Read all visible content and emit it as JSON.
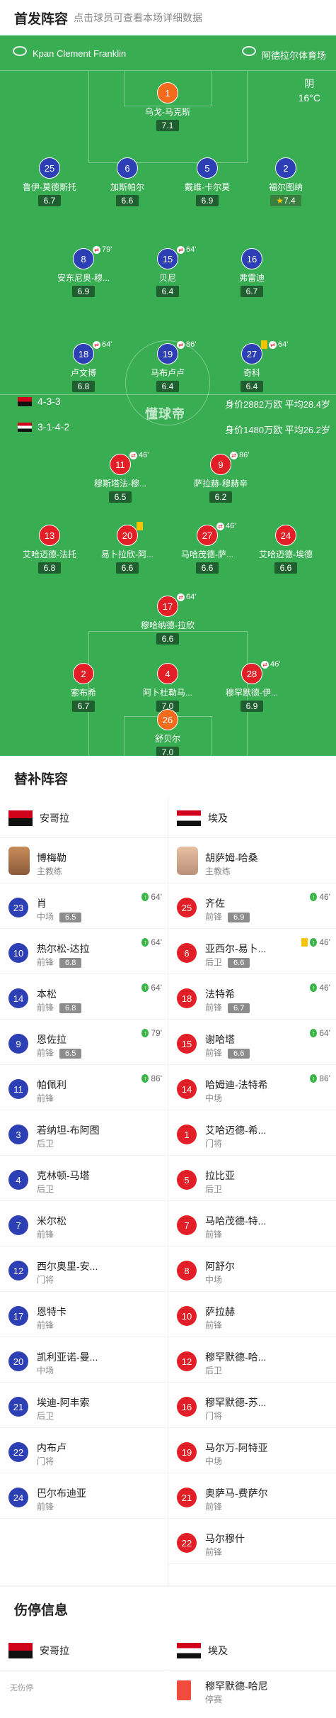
{
  "header": {
    "title": "首发阵容",
    "subtitle": "点击球员可查看本场详细数据"
  },
  "venue": {
    "left": "Kpan Clement Franklin",
    "right": "阿德拉尔体育场"
  },
  "weather": {
    "cond": "阴",
    "temp": "16°C"
  },
  "watermark": "懂球帝",
  "home_info": {
    "formation": "4-3-3",
    "value": "身价2882万欧 平均28.4岁"
  },
  "away_info": {
    "formation": "3-1-4-2",
    "value": "身价1480万欧 平均26.2岁"
  },
  "home_players": [
    {
      "num": "1",
      "name": "乌戈-马克斯",
      "rating": "7.1",
      "color": "o"
    },
    {
      "num": "25",
      "name": "鲁伊-莫德斯托",
      "rating": "6.7",
      "color": "b"
    },
    {
      "num": "6",
      "name": "加斯帕尔",
      "rating": "6.6",
      "color": "b"
    },
    {
      "num": "5",
      "name": "戴维-卡尔莫",
      "rating": "6.9",
      "color": "b"
    },
    {
      "num": "2",
      "name": "福尔图纳",
      "rating": "7.4",
      "color": "b",
      "star": "★"
    },
    {
      "num": "8",
      "name": "安东尼奥-穆...",
      "rating": "6.9",
      "color": "b",
      "sub": "79'"
    },
    {
      "num": "15",
      "name": "贝尼",
      "rating": "6.4",
      "color": "b",
      "sub": "64'"
    },
    {
      "num": "16",
      "name": "弗雷迪",
      "rating": "6.7",
      "color": "b",
      "cap": "C"
    },
    {
      "num": "18",
      "name": "卢文博",
      "rating": "6.8",
      "color": "b",
      "sub": "64'"
    },
    {
      "num": "19",
      "name": "马布卢卢",
      "rating": "6.4",
      "color": "b",
      "sub": "86'"
    },
    {
      "num": "27",
      "name": "奇科",
      "rating": "6.4",
      "color": "b",
      "sub": "64'",
      "yc": true
    }
  ],
  "away_players": [
    {
      "num": "11",
      "name": "穆斯塔法-穆...",
      "rating": "6.5",
      "color": "r",
      "sub": "46'"
    },
    {
      "num": "9",
      "name": "萨拉赫-穆赫辛",
      "rating": "6.2",
      "color": "r",
      "sub": "86'",
      "cap": "C"
    },
    {
      "num": "13",
      "name": "艾哈迈德-法托",
      "rating": "6.8",
      "color": "r"
    },
    {
      "num": "20",
      "name": "易卜拉欣-阿...",
      "rating": "6.6",
      "color": "r",
      "yc": true
    },
    {
      "num": "27",
      "name": "马哈茂德-萨...",
      "rating": "6.6",
      "color": "r",
      "sub": "46'"
    },
    {
      "num": "24",
      "name": "艾哈迈德-埃德",
      "rating": "6.6",
      "color": "r"
    },
    {
      "num": "17",
      "name": "穆哈纳德-拉欣",
      "rating": "6.6",
      "color": "r",
      "sub": "64'"
    },
    {
      "num": "2",
      "name": "索布希",
      "rating": "6.7",
      "color": "r"
    },
    {
      "num": "4",
      "name": "阿卜杜勒马...",
      "rating": "7.0",
      "color": "r"
    },
    {
      "num": "28",
      "name": "穆罕默德-伊...",
      "rating": "6.9",
      "color": "r",
      "sub": "46'"
    },
    {
      "num": "26",
      "name": "舒贝尔",
      "rating": "7.0",
      "color": "o"
    }
  ],
  "subs": {
    "title": "替补阵容",
    "home_team": "安哥拉",
    "away_team": "埃及",
    "home_coach": {
      "name": "博梅勒",
      "role": "主教练"
    },
    "away_coach": {
      "name": "胡萨姆-哈桑",
      "role": "主教练"
    },
    "home": [
      {
        "num": "23",
        "name": "肖",
        "pos": "中场",
        "rating": "6.5",
        "in": "64'"
      },
      {
        "num": "10",
        "name": "热尔松-达拉",
        "pos": "前锋",
        "rating": "6.8",
        "in": "64'"
      },
      {
        "num": "14",
        "name": "本松",
        "pos": "前锋",
        "rating": "6.8",
        "in": "64'"
      },
      {
        "num": "9",
        "name": "恩佐拉",
        "pos": "前锋",
        "rating": "6.5",
        "in": "79'"
      },
      {
        "num": "11",
        "name": "帕佩利",
        "pos": "前锋",
        "in": "86'"
      },
      {
        "num": "3",
        "name": "若纳坦-布阿图",
        "pos": "后卫"
      },
      {
        "num": "4",
        "name": "克林顿-马塔",
        "pos": "后卫"
      },
      {
        "num": "7",
        "name": "米尔松",
        "pos": "前锋"
      },
      {
        "num": "12",
        "name": "西尔奥里-安...",
        "pos": "门将"
      },
      {
        "num": "17",
        "name": "恩特卡",
        "pos": "前锋"
      },
      {
        "num": "20",
        "name": "凯利亚诺-曼...",
        "pos": "中场"
      },
      {
        "num": "21",
        "name": "埃迪-阿丰索",
        "pos": "后卫"
      },
      {
        "num": "22",
        "name": "内布卢",
        "pos": "门将"
      },
      {
        "num": "24",
        "name": "巴尔布迪亚",
        "pos": "前锋"
      }
    ],
    "away": [
      {
        "num": "25",
        "name": "齐佐",
        "pos": "前锋",
        "rating": "6.9",
        "in": "46'"
      },
      {
        "num": "6",
        "name": "亚西尔-易卜...",
        "pos": "后卫",
        "rating": "6.6",
        "in": "46'",
        "yc": true
      },
      {
        "num": "18",
        "name": "法特希",
        "pos": "前锋",
        "rating": "6.7",
        "in": "46'"
      },
      {
        "num": "15",
        "name": "谢哈塔",
        "pos": "前锋",
        "rating": "6.6",
        "in": "64'"
      },
      {
        "num": "14",
        "name": "哈姆迪-法特希",
        "pos": "中场",
        "in": "86'"
      },
      {
        "num": "1",
        "name": "艾哈迈德-希...",
        "pos": "门将"
      },
      {
        "num": "5",
        "name": "拉比亚",
        "pos": "后卫"
      },
      {
        "num": "7",
        "name": "马哈茂德-特...",
        "pos": "前锋"
      },
      {
        "num": "8",
        "name": "阿舒尔",
        "pos": "中场"
      },
      {
        "num": "10",
        "name": "萨拉赫",
        "pos": "前锋"
      },
      {
        "num": "12",
        "name": "穆罕默德-哈...",
        "pos": "后卫"
      },
      {
        "num": "16",
        "name": "穆罕默德-苏...",
        "pos": "门将"
      },
      {
        "num": "19",
        "name": "马尔万-阿特亚",
        "pos": "中场"
      },
      {
        "num": "21",
        "name": "奥萨马-费萨尔",
        "pos": "前锋"
      },
      {
        "num": "22",
        "name": "马尔穆什",
        "pos": "前锋"
      }
    ]
  },
  "injuries": {
    "title": "伤停信息",
    "home_team": "安哥拉",
    "away_team": "埃及",
    "home_none": "无伤停",
    "away": [
      {
        "name": "穆罕默德-哈尼",
        "status": "停赛"
      }
    ]
  }
}
